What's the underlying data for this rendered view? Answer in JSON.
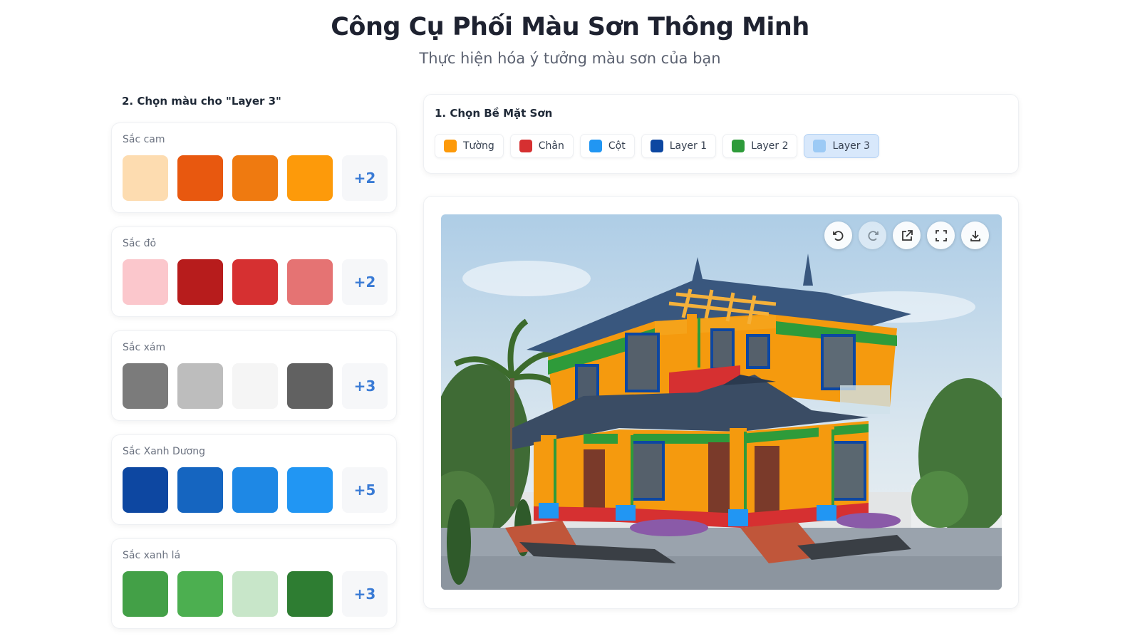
{
  "header": {
    "title": "Công Cụ Phối Màu Sơn Thông Minh",
    "subtitle": "Thực hiện hóa ý tưởng màu sơn của bạn"
  },
  "color_picker": {
    "title": "2. Chọn màu cho \"Layer 3\"",
    "groups": [
      {
        "name": "Sắc cam",
        "swatches": [
          "#fddcb0",
          "#e8580f",
          "#ef7a10",
          "#fd9a0a"
        ],
        "more": "+2"
      },
      {
        "name": "Sắc đỏ",
        "swatches": [
          "#fbc7cc",
          "#b71c1c",
          "#d63031",
          "#e57373"
        ],
        "more": "+2"
      },
      {
        "name": "Sắc xám",
        "swatches": [
          "#7b7b7b",
          "#bdbdbd",
          "#f5f5f5",
          "#616161"
        ],
        "more": "+3"
      },
      {
        "name": "Sắc Xanh Dương",
        "swatches": [
          "#0d47a1",
          "#1565c0",
          "#1e88e5",
          "#2196f3"
        ],
        "more": "+5"
      },
      {
        "name": "Sắc xanh lá",
        "swatches": [
          "#43a047",
          "#4caf50",
          "#c8e6c9",
          "#2e7d32"
        ],
        "more": "+3"
      }
    ]
  },
  "surface_selector": {
    "title": "1. Chọn Bề Mặt Sơn",
    "active": "Layer 3",
    "surfaces": [
      {
        "label": "Tường",
        "color": "#fd9a0a"
      },
      {
        "label": "Chân",
        "color": "#d63031"
      },
      {
        "label": "Cột",
        "color": "#2196f3"
      },
      {
        "label": "Layer 1",
        "color": "#0d47a1"
      },
      {
        "label": "Layer 2",
        "color": "#2e9b3a"
      },
      {
        "label": "Layer 3",
        "color": "#9ccaf5"
      }
    ]
  },
  "preview": {
    "toolbar": [
      "undo-icon",
      "redo-icon",
      "external-link-icon",
      "fullscreen-icon",
      "download-icon"
    ]
  }
}
